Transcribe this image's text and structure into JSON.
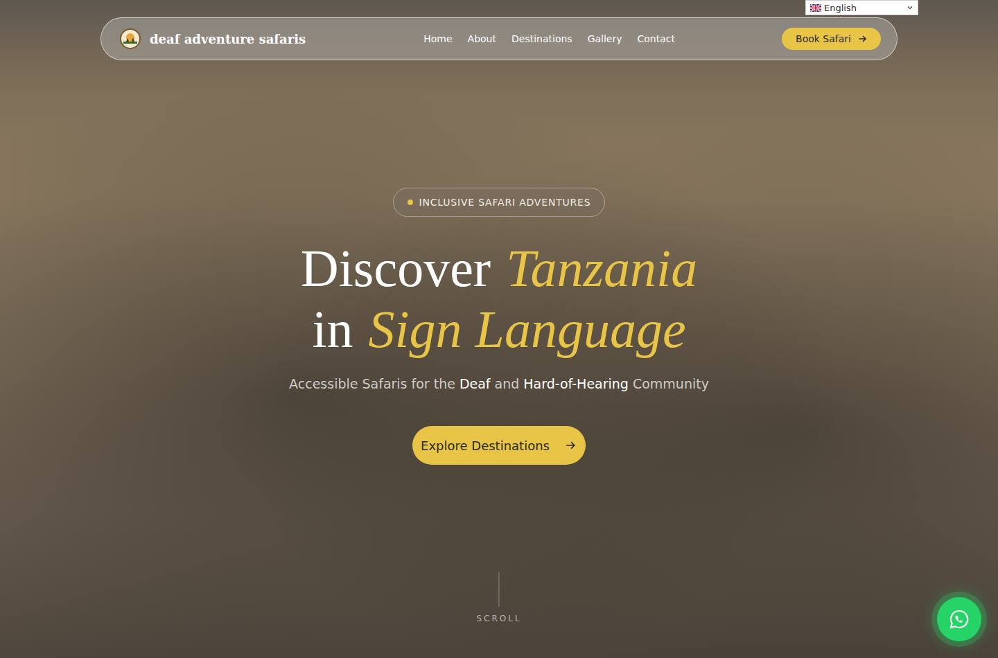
{
  "language_selector": {
    "label": "English"
  },
  "nav": {
    "logo_text": "deaf adventure safaris",
    "items": [
      {
        "label": "Home"
      },
      {
        "label": "About"
      },
      {
        "label": "Destinations"
      },
      {
        "label": "Gallery"
      },
      {
        "label": "Contact"
      }
    ],
    "cta": "Book Safari"
  },
  "hero": {
    "badge": "INCLUSIVE SAFARI ADVENTURES",
    "headline": [
      [
        {
          "text": "Discover",
          "kind": "plain"
        },
        {
          "text": "Tanzania",
          "kind": "accent"
        }
      ],
      [
        {
          "text": "in",
          "kind": "plain"
        },
        {
          "text": "Sign Language",
          "kind": "accent"
        }
      ]
    ],
    "subtitle": [
      {
        "text": "Accessible Safaris for the",
        "emphasis": false
      },
      {
        "text": "Deaf",
        "emphasis": true
      },
      {
        "text": "and",
        "emphasis": false
      },
      {
        "text": "Hard-of-Hearing",
        "emphasis": true
      },
      {
        "text": "Community",
        "emphasis": false
      }
    ],
    "button": "Explore Destinations",
    "scroll": "SCROLL"
  }
}
